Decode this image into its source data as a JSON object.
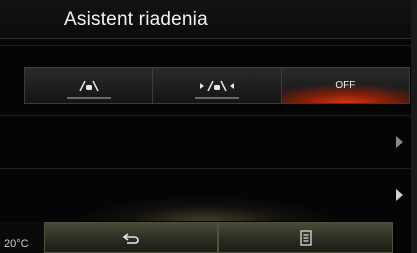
{
  "header": {
    "title": "Asistent riadenia"
  },
  "mode_selector": {
    "options": [
      {
        "icon": "lane-keep-icon",
        "label": "",
        "active": false
      },
      {
        "icon": "lane-keep-assist-icon",
        "label": "",
        "active": false
      },
      {
        "icon": "",
        "label": "OFF",
        "active": true
      }
    ],
    "active_color": "#d23a14"
  },
  "rows": [
    {
      "icon": "chevron-right-icon"
    },
    {
      "icon": "chevron-right-icon"
    }
  ],
  "bottom_bar": {
    "temperature": "20°C",
    "back_icon": "back-arrow-icon",
    "menu_icon": "menu-list-icon"
  }
}
